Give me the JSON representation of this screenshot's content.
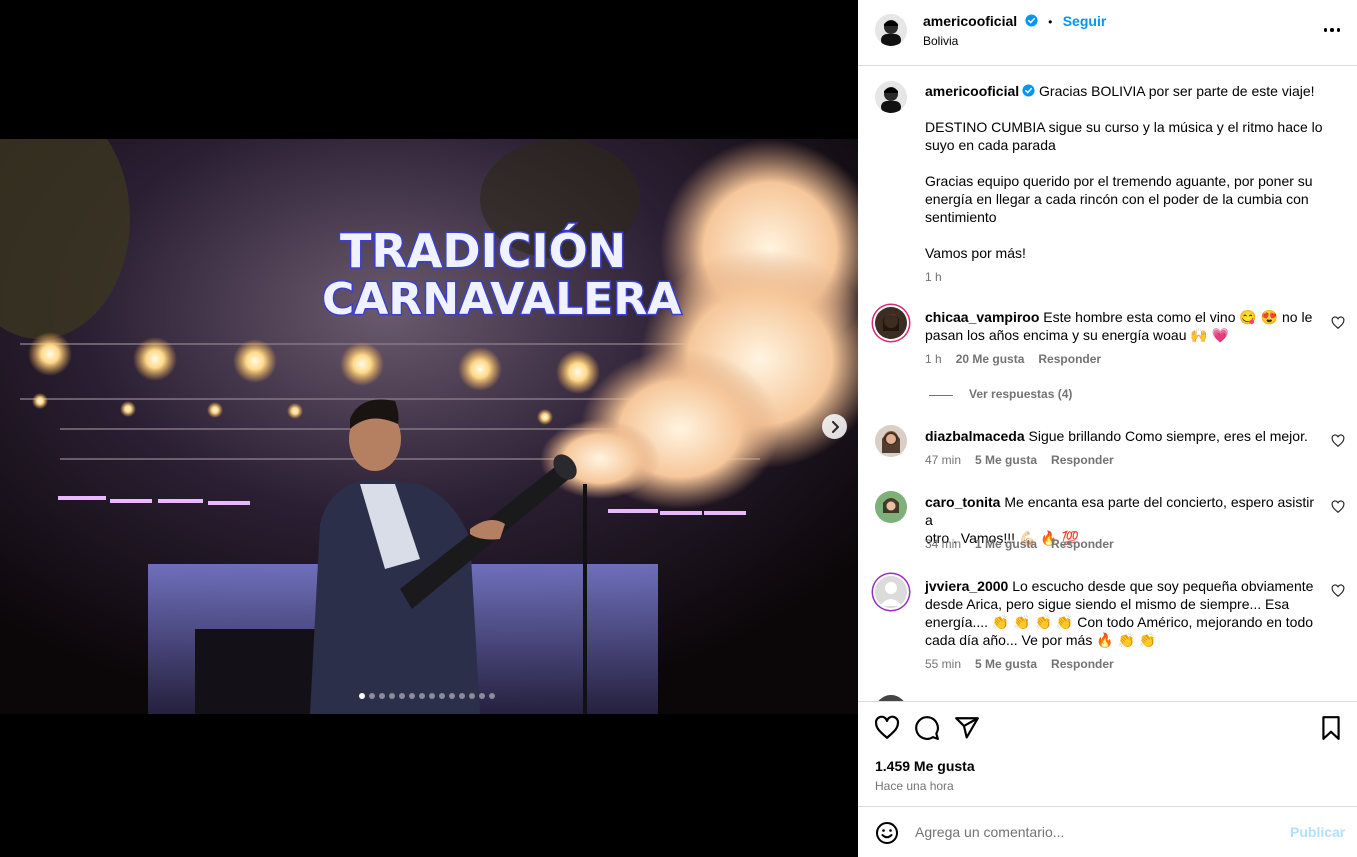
{
  "post": {
    "username": "americooficial",
    "follow_label": "Seguir",
    "separator": "•",
    "location": "Bolivia",
    "caption_user": "americooficial",
    "caption_lines": [
      "Gracias BOLIVIA por ser parte de este viaje!",
      "DESTINO CUMBIA sigue su curso y la música y el ritmo hace lo",
      "suyo en cada parada",
      "Gracias equipo querido por el tremendo aguante, por poner su",
      "energía en llegar a cada rincón con el poder de la cumbia con",
      "sentimiento",
      "Vamos por más!"
    ],
    "caption_time": "1 h",
    "photo_sign": [
      "TRADICIÓN",
      "CARNAVALERA"
    ],
    "carousel": {
      "total": 14,
      "active": 0
    }
  },
  "comments": [
    {
      "user": "chicaa_vampiroo",
      "lines": [
        "Este hombre esta como el vino 😋 😍  no le",
        "pasan los años encima y su energía woau 🙌 💗"
      ],
      "time": "1 h",
      "likes": "20 Me gusta",
      "reply": "Responder",
      "view_replies": "Ver respuestas (4)"
    },
    {
      "user": "diazbalmaceda",
      "lines": [
        "Sigue brillando Como siempre, eres el mejor."
      ],
      "time": "47 min",
      "likes": "5 Me gusta",
      "reply": "Responder"
    },
    {
      "user": "caro_tonita",
      "lines": [
        "Me encanta esa parte del concierto, espero asistir a",
        "otro . Vamos!!! 💪🏻 🔥 💯"
      ],
      "time": "34 min",
      "likes": "1 Me gusta",
      "reply": "Responder"
    },
    {
      "user": "jvviera_2000",
      "lines": [
        "Lo escucho desde que soy pequeña obviamente",
        "desde Arica, pero sigue siendo el mismo de siempre... Esa",
        "energía.... 👏 👏 👏 👏  Con todo Américo, mejorando en todo",
        "cada día año... Ve por más  🔥 👏 👏"
      ],
      "time": "55 min",
      "likes": "5 Me gusta",
      "reply": "Responder"
    }
  ],
  "stats": {
    "likes": "1.459 Me gusta",
    "ago": "Hace una hora"
  },
  "compose": {
    "placeholder": "Agrega un comentario...",
    "publish": "Publicar"
  },
  "icons": [
    "heart-icon",
    "comment-icon",
    "share-icon",
    "bookmark-icon",
    "emoji-icon",
    "more-icon",
    "chevron-right-icon",
    "verified-icon"
  ],
  "colors": {
    "link": "#0095f6",
    "publish_disabled": "#b2dffc",
    "muted": "#737373",
    "border": "#dbdbdb"
  }
}
